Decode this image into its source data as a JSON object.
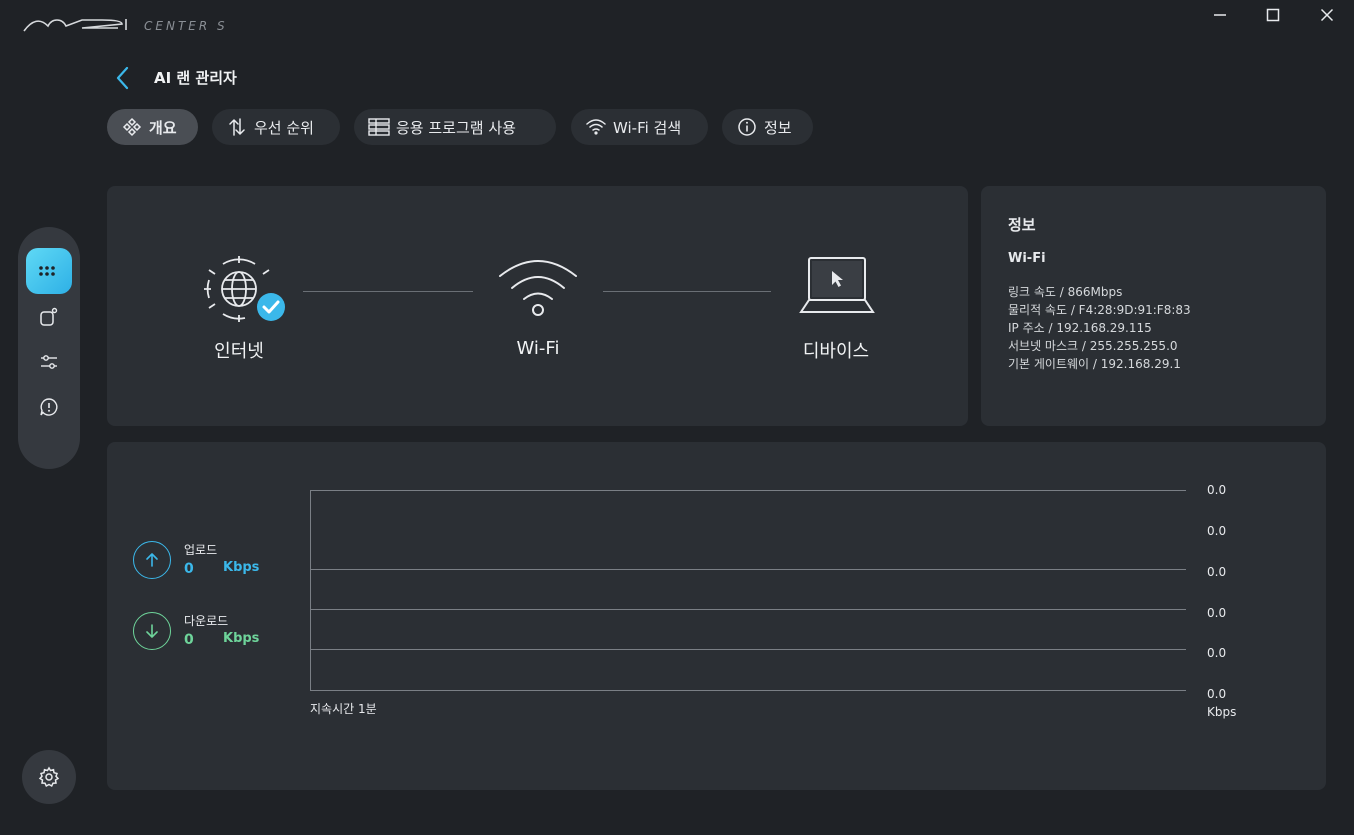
{
  "app": {
    "title": "MSI CENTER S",
    "colors": {
      "accent": "#3bb8ea",
      "upload": "#3bb8ea",
      "download": "#6ed49a",
      "panel": "#2b2f34",
      "background": "#1f2226"
    }
  },
  "window": {
    "minimize_icon": "minimize-icon",
    "maximize_icon": "maximize-icon",
    "close_icon": "close-icon"
  },
  "header": {
    "title": "AI 랜 관리자",
    "back_icon": "chevron-left-icon"
  },
  "tabs": [
    {
      "label": "개요",
      "icon": "overview-icon",
      "active": true
    },
    {
      "label": "우선 순위",
      "icon": "priority-arrows-icon",
      "active": false
    },
    {
      "label": "응용 프로그램 사용",
      "icon": "app-list-icon",
      "active": false
    },
    {
      "label": "Wi-Fi 검색",
      "icon": "wifi-icon",
      "active": false
    },
    {
      "label": "정보",
      "icon": "info-icon",
      "active": false
    }
  ],
  "rail": {
    "items": [
      {
        "icon": "dashboard-dots-icon",
        "active": true
      },
      {
        "icon": "device-icon",
        "active": false
      },
      {
        "icon": "sliders-icon",
        "active": false
      },
      {
        "icon": "alert-icon",
        "active": false
      }
    ],
    "settings_icon": "gear-icon"
  },
  "topology": {
    "internet": "인터넷",
    "wifi": "Wi-Fi",
    "device": "디바이스"
  },
  "info": {
    "title": "정보",
    "connection": "Wi-Fi",
    "lines": [
      "링크 속도 / 866Mbps",
      "물리적 속도 / F4:28:9D:91:F8:83",
      "IP 주소 / 192.168.29.115",
      "서브넷 마스크 / 255.255.255.0",
      "기본 게이트웨이 / 192.168.29.1"
    ]
  },
  "traffic": {
    "upload": {
      "label": "업로드",
      "value": "0",
      "unit": "Kbps"
    },
    "download": {
      "label": "다운로드",
      "value": "0",
      "unit": "Kbps"
    },
    "axis_labels": [
      "0.0",
      "0.0",
      "0.0",
      "0.0",
      "0.0",
      "0.0"
    ],
    "duration": "지속시간 1분",
    "unit": "Kbps"
  }
}
